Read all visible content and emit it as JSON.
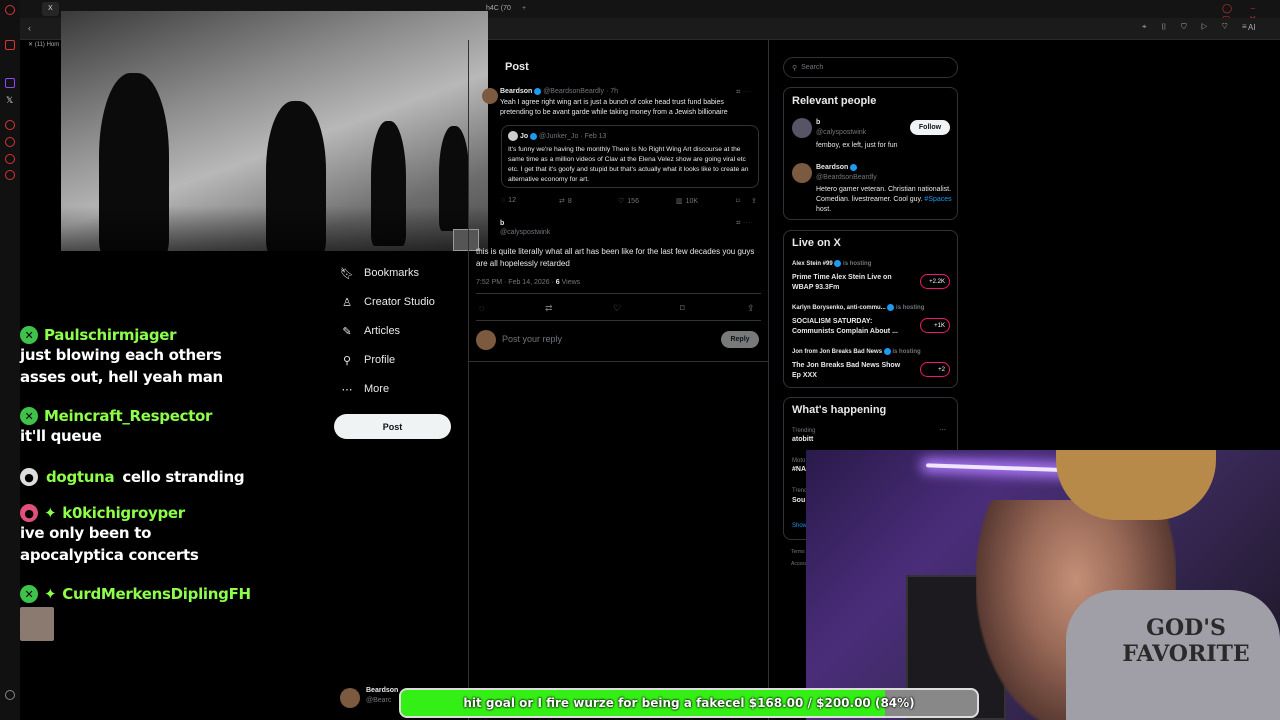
{
  "browser": {
    "tabs": [
      "X",
      "(11) Hom",
      "h4C (70"
    ],
    "toolbar_icons": [
      "back-icon",
      "forward-icon",
      "reload-icon",
      "bookmark-icon",
      "shield-icon",
      "play-icon",
      "heart-icon",
      "menu-icon"
    ],
    "ai_label": "AI"
  },
  "nav": {
    "items": [
      {
        "label": "Bookmarks",
        "icon": "bookmark-icon"
      },
      {
        "label": "Creator Studio",
        "icon": "person-icon"
      },
      {
        "label": "Articles",
        "icon": "article-icon"
      },
      {
        "label": "Profile",
        "icon": "profile-icon"
      },
      {
        "label": "More",
        "icon": "more-icon"
      }
    ],
    "post_button": "Post",
    "account_name": "Beardson",
    "account_handle": "@Bearc"
  },
  "chat": [
    {
      "name": "Paulschirmjager",
      "message": "just blowing each others asses out, hell yeah man"
    },
    {
      "name": "Meincraft_Respector",
      "message": "it'll queue"
    },
    {
      "name": "dogtuna",
      "message": "cello stranding"
    },
    {
      "name": "k0kichigroyper",
      "message": "ive only been to apocalyptica concerts"
    },
    {
      "name": "CurdMerkensDiplingFH",
      "message": ""
    }
  ],
  "post": {
    "header": "Post",
    "tweet1": {
      "name": "Beardson",
      "handle": "@BeardsonBeardly · 7h",
      "text": "Yeah I agree right wing art is just a bunch of coke head trust fund babies pretending to be avant garde while taking money from a Jewish billionaire"
    },
    "quote": {
      "name": "Jo",
      "handle": "@Junker_Jo · Feb 13",
      "text": "It's funny we're having the monthly There Is No Right Wing Art discourse at the same time as a million videos of Clav at the Elena Velez show are going viral etc etc. I get that it's goofy and stupid but that's actually what it looks like to create an alternative economy for art.",
      "stats": {
        "replies": "12",
        "reposts": "8",
        "likes": "156",
        "views": "10K"
      }
    },
    "tweet2": {
      "name": "b",
      "handle": "@calyspostwink",
      "text": "this is quite literally what all art has been like for the last few decades you guys are all hopelessly retarded",
      "meta": "7:52 PM · Feb 14, 2026 · ",
      "views": "6",
      "views_label": " Views"
    },
    "reply_placeholder": "Post your reply",
    "reply_button": "Reply"
  },
  "right": {
    "search_placeholder": "Search",
    "relevant": {
      "title": "Relevant people",
      "people": [
        {
          "name": "b",
          "handle": "@calyspostwink",
          "bio": "femboy, ex left, just for fun",
          "button": "Follow"
        },
        {
          "name": "Beardson",
          "handle": "@BeardsonBeardly",
          "bio": "Hetero gamer veteran. Christian nationalist. Comedian. livestreamer. Cool guy. ",
          "bio_link": "#Spaces",
          "bio_end": " host."
        }
      ]
    },
    "live": {
      "title": "Live on X",
      "items": [
        {
          "host": "Alex Stein #99",
          "status": "is hosting",
          "title": "Prime Time Alex Stein Live on WBAP 93.3Fm",
          "count": "+2.2K"
        },
        {
          "host": "Karlyn Borysenko, anti-commu...",
          "status": "is hosting",
          "title": "SOCIALISM SATURDAY: Communists Complain About ...",
          "count": "+1K"
        },
        {
          "host": "Jon from Jon Breaks Bad News",
          "status": "is hosting",
          "title": "The Jon Breaks Bad News Show Ep XXX",
          "count": "+2"
        }
      ]
    },
    "happening": {
      "title": "What's happening",
      "trending_label": "Trending",
      "trend1": "atobitt",
      "frag": [
        "Moto",
        "#NA",
        "Trend",
        "Sou",
        "Show"
      ],
      "terms": "Terms",
      "access": "Access"
    }
  },
  "webcam": {
    "shirt_text": "GOD'S FAVORITE"
  },
  "goal": {
    "text": "hit goal or I fire wurze for being a fakecel $168.00 / $200.00 (84%)",
    "progress": 0.84
  },
  "colors": {
    "chat_name": "#8dff4a",
    "goal_fill": "#34ef15",
    "x_blue": "#1d9bf0",
    "live_pink": "#f0186e"
  }
}
